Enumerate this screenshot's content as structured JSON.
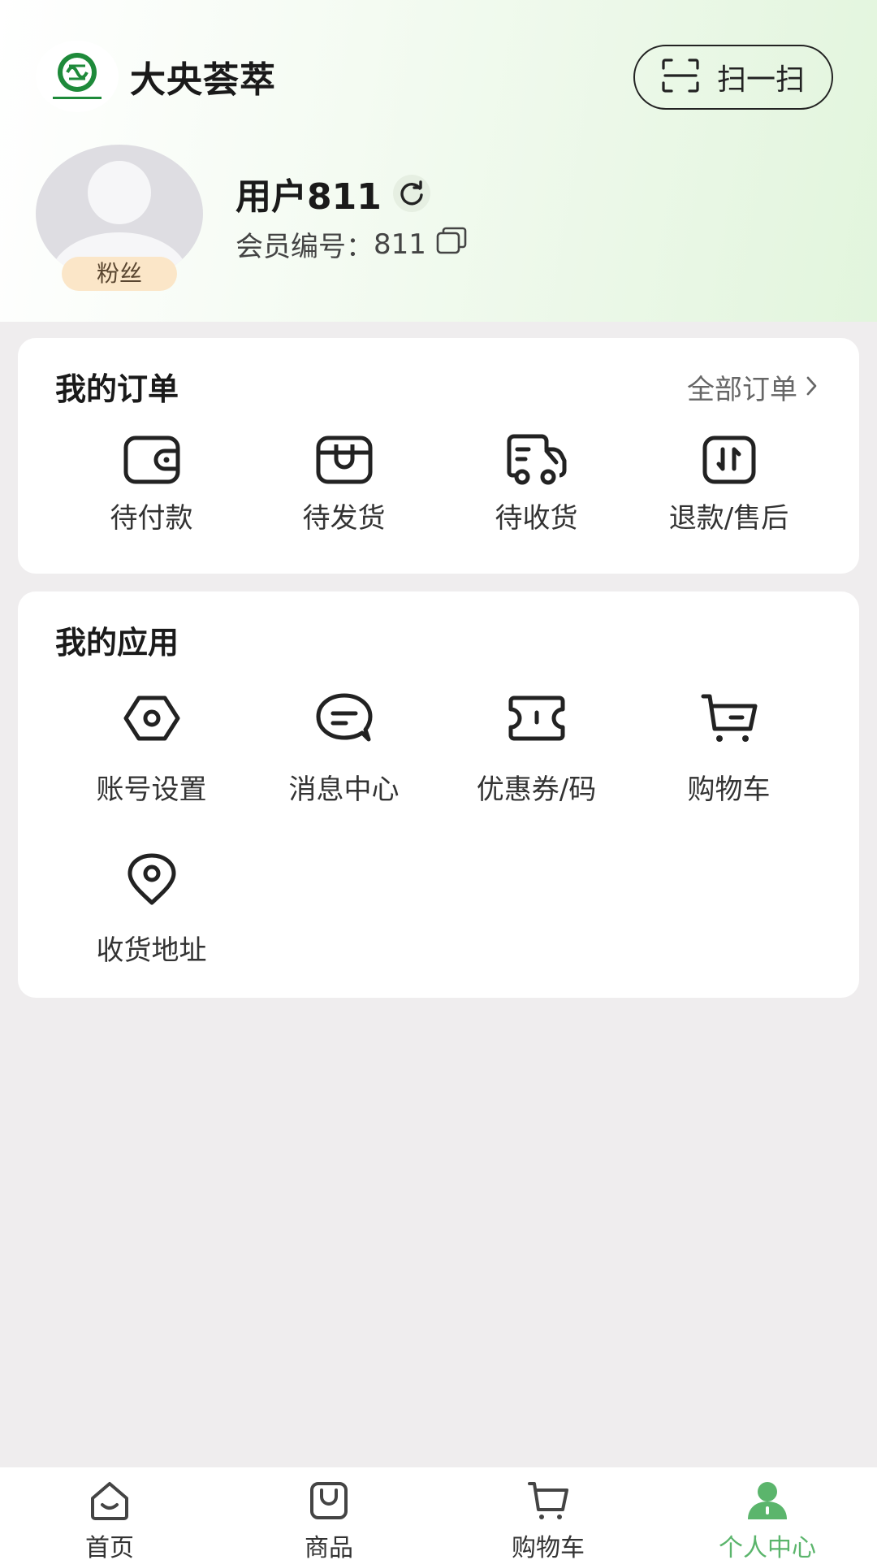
{
  "header": {
    "brand_name": "大央荟萃",
    "scan_label": "扫一扫"
  },
  "user": {
    "name": "用户811",
    "badge": "粉丝",
    "member_label": "会员编号：",
    "member_id": "811"
  },
  "orders": {
    "title": "我的订单",
    "all_label": "全部订单",
    "items": [
      {
        "label": "待付款",
        "icon": "wallet-icon"
      },
      {
        "label": "待发货",
        "icon": "box-icon"
      },
      {
        "label": "待收货",
        "icon": "truck-icon"
      },
      {
        "label": "退款/售后",
        "icon": "refund-icon"
      }
    ]
  },
  "apps": {
    "title": "我的应用",
    "items": [
      {
        "label": "账号设置",
        "icon": "settings-icon"
      },
      {
        "label": "消息中心",
        "icon": "message-icon"
      },
      {
        "label": "优惠券/码",
        "icon": "coupon-icon"
      },
      {
        "label": "购物车",
        "icon": "cart-icon"
      },
      {
        "label": "收货地址",
        "icon": "location-icon"
      }
    ]
  },
  "tabbar": {
    "active_color": "#5bb56c",
    "items": [
      {
        "label": "首页",
        "icon": "home-icon"
      },
      {
        "label": "商品",
        "icon": "bag-icon"
      },
      {
        "label": "购物车",
        "icon": "cart-icon"
      },
      {
        "label": "个人中心",
        "icon": "profile-icon",
        "active": true
      }
    ]
  }
}
